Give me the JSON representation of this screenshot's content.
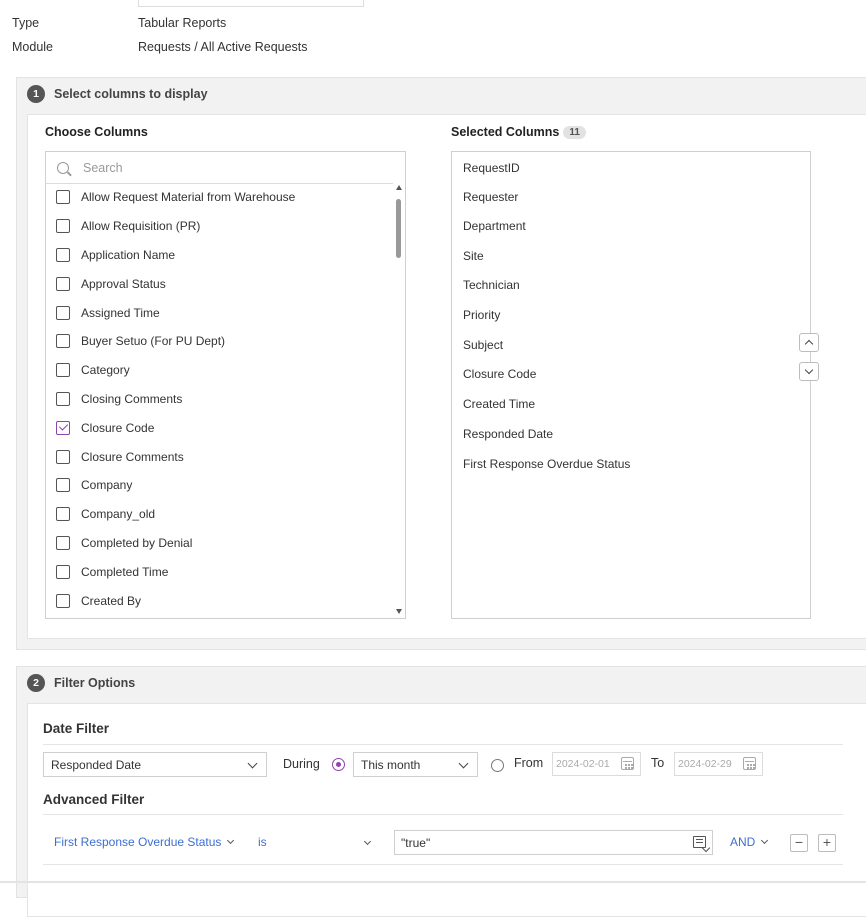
{
  "report_meta": {
    "type_label": "Type",
    "type_value": "Tabular Reports",
    "module_label": "Module",
    "module_value": "Requests / All Active Requests"
  },
  "step1": {
    "number": "1",
    "title": "Select columns to display",
    "choose_title": "Choose Columns",
    "search_placeholder": "Search",
    "columns": [
      {
        "label": "Allow Request Material from Warehouse",
        "checked": false
      },
      {
        "label": "Allow Requisition (PR)",
        "checked": false
      },
      {
        "label": "Application Name",
        "checked": false
      },
      {
        "label": "Approval Status",
        "checked": false
      },
      {
        "label": "Assigned Time",
        "checked": false
      },
      {
        "label": "Buyer Setuo (For PU Dept)",
        "checked": false
      },
      {
        "label": "Category",
        "checked": false
      },
      {
        "label": "Closing Comments",
        "checked": false
      },
      {
        "label": "Closure Code",
        "checked": true
      },
      {
        "label": "Closure Comments",
        "checked": false
      },
      {
        "label": "Company",
        "checked": false
      },
      {
        "label": "Company_old",
        "checked": false
      },
      {
        "label": "Completed by Denial",
        "checked": false
      },
      {
        "label": "Completed Time",
        "checked": false
      },
      {
        "label": "Created By",
        "checked": false
      }
    ],
    "selected_title": "Selected Columns",
    "selected_count": "11",
    "selected_columns": [
      "RequestID",
      "Requester",
      "Department",
      "Site",
      "Technician",
      "Priority",
      "Subject",
      "Closure Code",
      "Created Time",
      "Responded Date",
      "First Response Overdue Status"
    ]
  },
  "step2": {
    "number": "2",
    "title": "Filter Options",
    "date_filter": {
      "heading": "Date Filter",
      "field": "Responded Date",
      "during_label": "During",
      "during_selected": true,
      "period": "This month",
      "from_label": "From",
      "from_value": "2024-02-01",
      "to_label": "To",
      "to_value": "2024-02-29"
    },
    "advanced_filter": {
      "heading": "Advanced Filter",
      "field": "First Response Overdue Status",
      "operator": "is",
      "value": "\"true\"",
      "logic": "AND",
      "remove_symbol": "−",
      "add_symbol": "+"
    }
  },
  "colors": {
    "accent": "#8e44ad",
    "link": "#3d6fd1"
  }
}
